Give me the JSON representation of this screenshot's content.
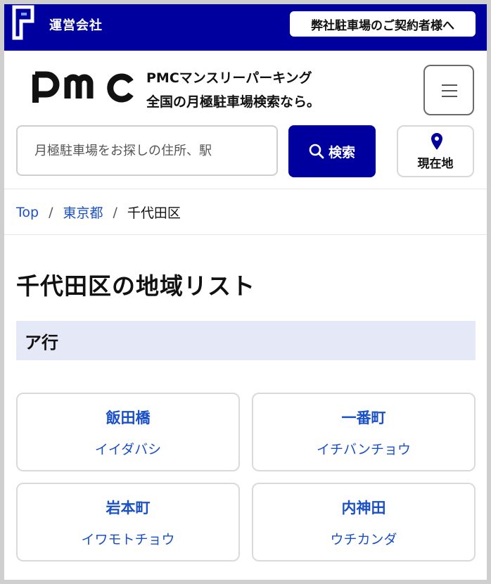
{
  "topbar": {
    "company_link": "運営会社",
    "contract_button": "弊社駐車場のご契約者様へ",
    "logo_icon": "p-logo-icon"
  },
  "header": {
    "brand_logo_text": "pmc",
    "brand_title": "PMCマンスリーパーキング",
    "brand_subtitle": "全国の月極駐車場検索なら。",
    "menu_icon": "hamburger-icon"
  },
  "search": {
    "placeholder": "月極駐車場をお探しの住所、駅",
    "button_label": "検索",
    "button_icon": "search-icon",
    "location_label": "現在地",
    "location_icon": "map-pin-icon"
  },
  "breadcrumb": {
    "items": [
      "Top",
      "東京都",
      "千代田区"
    ],
    "separator": "/"
  },
  "page": {
    "title": "千代田区の地域リスト",
    "section_label": "ア行"
  },
  "areas": [
    {
      "name": "飯田橋",
      "kana": "イイダバシ"
    },
    {
      "name": "一番町",
      "kana": "イチバンチョウ"
    },
    {
      "name": "岩本町",
      "kana": "イワモトチョウ"
    },
    {
      "name": "内神田",
      "kana": "ウチカンダ"
    }
  ],
  "colors": {
    "brand_navy": "#00009e",
    "link_blue": "#1a50c8",
    "section_bg": "#e5e8f6"
  }
}
